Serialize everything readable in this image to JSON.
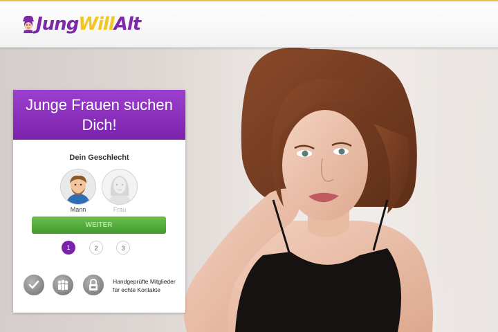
{
  "header": {
    "logo_part1": "Jung",
    "logo_part2": "Will",
    "logo_part3": "Alt"
  },
  "signup": {
    "headline": "Junge Frauen suchen Dich!",
    "gender_question": "Dein Geschlecht",
    "options": [
      {
        "label": "Mann",
        "selected": true
      },
      {
        "label": "Frau",
        "selected": false
      }
    ],
    "continue_label": "WEITER",
    "steps": [
      "1",
      "2",
      "3"
    ],
    "current_step": 1,
    "trust_icons": [
      "checkmark-seal-icon",
      "members-group-icon",
      "ssl-lock-icon"
    ],
    "trust_text": "Handgeprüfte Mitglieder für echte Kontakte"
  },
  "colors": {
    "brand_purple": "#7b22ad",
    "brand_yellow": "#f2c623",
    "cta_green": "#4aa835"
  }
}
